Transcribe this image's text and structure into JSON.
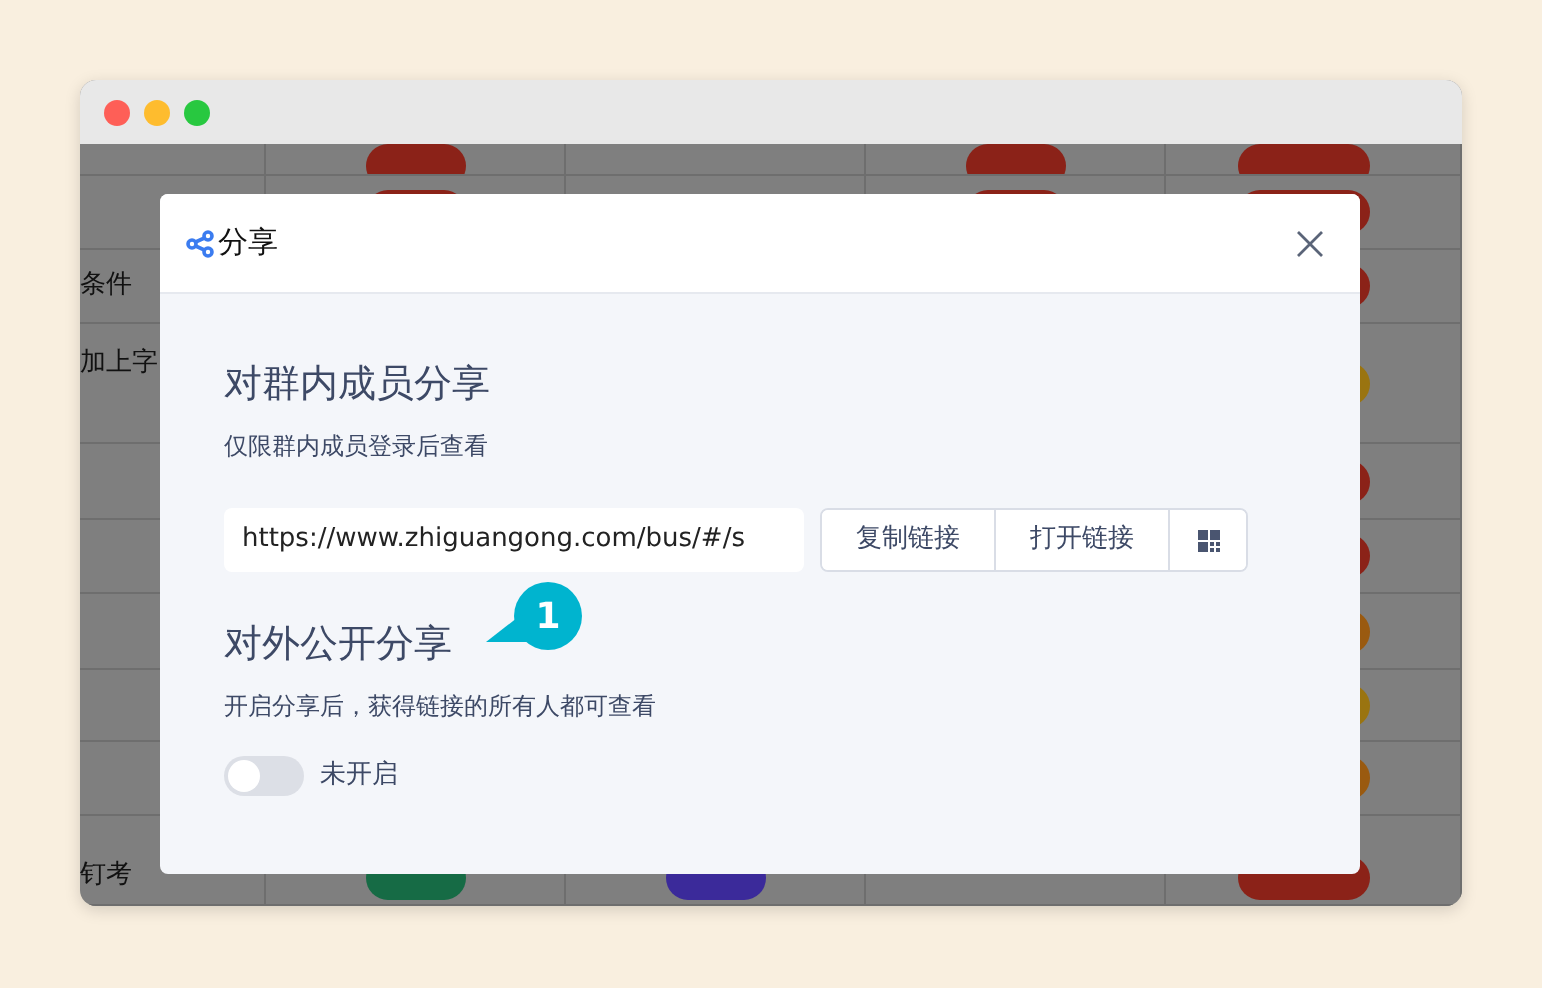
{
  "background_table": {
    "rows": [
      {
        "cells": [
          {
            "kind": "empty"
          },
          {
            "kind": "badge",
            "color": "#8b2218"
          },
          {
            "kind": "empty"
          },
          {
            "kind": "badge",
            "color": "#8b2218"
          },
          {
            "kind": "badge",
            "color": "#8b2218"
          }
        ]
      },
      {
        "cells": [
          {
            "kind": "empty"
          },
          {
            "kind": "badge",
            "color": "#8b2218"
          },
          {
            "kind": "empty"
          },
          {
            "kind": "badge",
            "color": "#8b2218"
          },
          {
            "kind": "badge",
            "color": "#8b2218"
          }
        ]
      },
      {
        "cells": [
          {
            "kind": "text",
            "text": "条件"
          },
          {
            "kind": "empty"
          },
          {
            "kind": "empty"
          },
          {
            "kind": "empty"
          },
          {
            "kind": "badge",
            "color": "#8b2218"
          }
        ]
      },
      {
        "cells": [
          {
            "kind": "text",
            "text": "加上字"
          },
          {
            "kind": "empty"
          },
          {
            "kind": "empty"
          },
          {
            "kind": "empty"
          },
          {
            "kind": "badge",
            "color": "#9a7410"
          }
        ]
      },
      {
        "cells": [
          {
            "kind": "empty"
          },
          {
            "kind": "empty"
          },
          {
            "kind": "empty"
          },
          {
            "kind": "empty"
          },
          {
            "kind": "badge",
            "color": "#8b2218"
          }
        ]
      },
      {
        "cells": [
          {
            "kind": "empty"
          },
          {
            "kind": "empty"
          },
          {
            "kind": "empty"
          },
          {
            "kind": "empty"
          },
          {
            "kind": "badge",
            "color": "#8b2218"
          }
        ]
      },
      {
        "cells": [
          {
            "kind": "empty"
          },
          {
            "kind": "empty"
          },
          {
            "kind": "empty"
          },
          {
            "kind": "empty"
          },
          {
            "kind": "badge",
            "color": "#9a5a10"
          }
        ]
      },
      {
        "cells": [
          {
            "kind": "empty"
          },
          {
            "kind": "empty"
          },
          {
            "kind": "empty"
          },
          {
            "kind": "empty"
          },
          {
            "kind": "badge",
            "color": "#9a7410"
          }
        ]
      },
      {
        "cells": [
          {
            "kind": "empty"
          },
          {
            "kind": "empty"
          },
          {
            "kind": "empty"
          },
          {
            "kind": "empty"
          },
          {
            "kind": "badge",
            "color": "#9a5a10"
          }
        ]
      },
      {
        "cells": [
          {
            "kind": "text",
            "text": "钉考"
          },
          {
            "kind": "badge",
            "color": "#166b45"
          },
          {
            "kind": "badge",
            "color": "#3b2a9a"
          },
          {
            "kind": "empty"
          },
          {
            "kind": "badge",
            "color": "#8b2218"
          }
        ]
      }
    ]
  },
  "dialog": {
    "title": "分享",
    "member_share": {
      "heading": "对群内成员分享",
      "description": "仅限群内成员登录后查看",
      "link": "https://www.zhiguangong.com/bus/#/s",
      "buttons": [
        "复制链接",
        "打开链接"
      ]
    },
    "callout": "1",
    "public_share": {
      "heading": "对外公开分享",
      "description": "开启分享后，获得链接的所有人都可查看",
      "toggle": {
        "on": false,
        "label": "未开启"
      }
    }
  }
}
